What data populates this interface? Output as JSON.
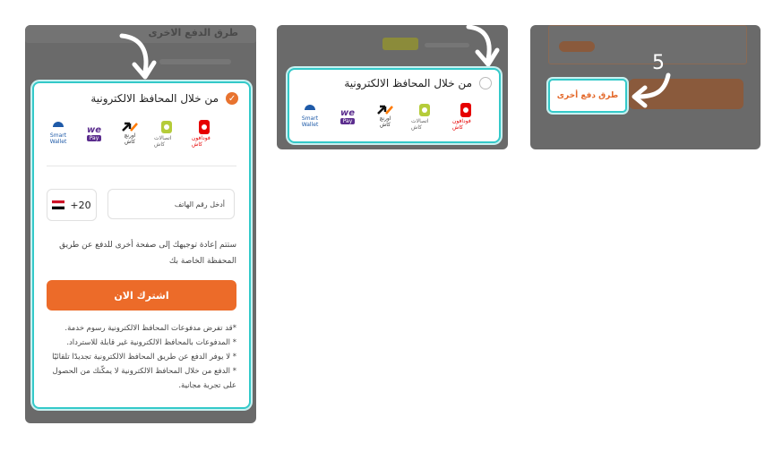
{
  "colors": {
    "accent": "#ec6b29",
    "highlight": "#34c9c9",
    "overlay": "#6a6a6a"
  },
  "shared": {
    "wallet_option_label": "من خلال المحافظ الالكترونية",
    "wallets": [
      {
        "name": "فودافون كاش",
        "icon": "vodafone-cash-icon"
      },
      {
        "name": "اتصالات كاش",
        "icon": "etisalat-cash-icon"
      },
      {
        "name": "اورنچ كاش",
        "icon": "orange-cash-icon"
      },
      {
        "name": "we pay",
        "icon": "we-pay-icon"
      },
      {
        "name": "Smart Wallet",
        "icon": "smart-wallet-icon"
      }
    ]
  },
  "panel1": {
    "background_title": "طرق الدفع الاخرى",
    "phone_placeholder": "أدخل رقم الهاتف",
    "country_code": "+20",
    "redirect_note": "ستتم إعادة توجيهك إلى صفحة أخرى للدفع عن طريق المحفظة الخاصة بك",
    "subscribe_button": "اشترك الان",
    "disclaimers": [
      "*قد تفرض مدفوعات المحافظ الالكترونية رسوم خدمة.",
      "* المدفوعات بالمحافظ الالكترونية غير قابلة للاسترداد.",
      "* لا يوفر الدفع عن طريق المحافظ الالكترونية تجديدًا تلقائيًا",
      "* الدفع من خلال المحافظ الالكترونية لا يمكّنك من الحصول على تجربة مجانية."
    ]
  },
  "panel3": {
    "step_number": "5",
    "other_methods_button": "طرق دفع أخرى"
  }
}
